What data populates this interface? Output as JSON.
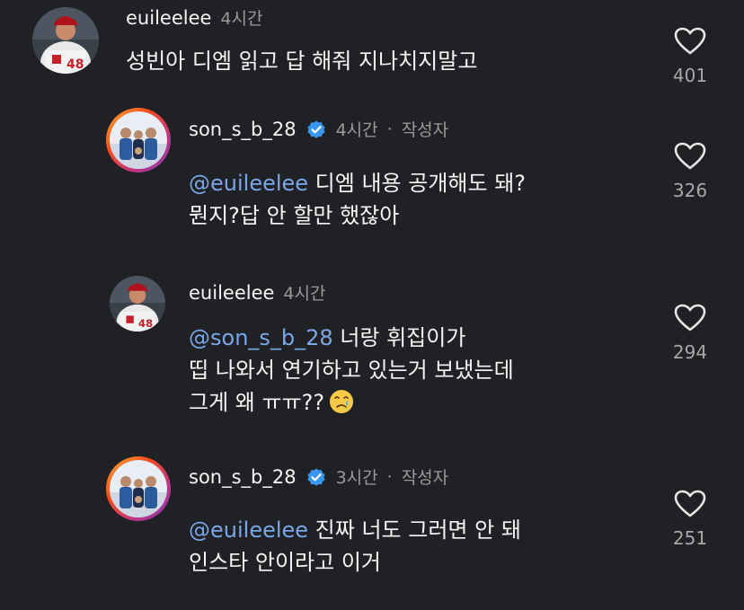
{
  "comments": [
    {
      "username": "euileelee",
      "time": "4시간",
      "author_tag": "",
      "mention": "",
      "lines": [
        "성빈아 디엠 읽고 답 해줘 지나치지말고"
      ],
      "likes": "401"
    },
    {
      "username": "son_s_b_28",
      "time": "4시간",
      "author_tag": "작성자",
      "mention": "@euileelee",
      "lines": [
        " 디엠 내용 공개해도 돼?",
        "뭔지?답 안 할만 했잖아"
      ],
      "likes": "326"
    },
    {
      "username": "euileelee",
      "time": "4시간",
      "author_tag": "",
      "mention": "@son_s_b_28",
      "lines": [
        " 너랑 휘집이가",
        "띱 나와서 연기하고 있는거 보냈는데",
        "그게 왜 ㅠㅠ??"
      ],
      "likes": "294"
    },
    {
      "username": "son_s_b_28",
      "time": "3시간",
      "author_tag": "작성자",
      "mention": "@euileelee",
      "lines": [
        " 진짜 너도 그러면 안 돼",
        "인스타 안이라고 이거"
      ],
      "likes": "251"
    }
  ],
  "separator": "·",
  "colors": {
    "background": "#202124",
    "mention": "#7aa7e8",
    "verified": "#3897f0",
    "muted": "#9a9a9a"
  },
  "icons": {
    "like": "heart-outline-icon",
    "verified": "verified-badge-icon",
    "emoji": "crying-face-emoji"
  }
}
